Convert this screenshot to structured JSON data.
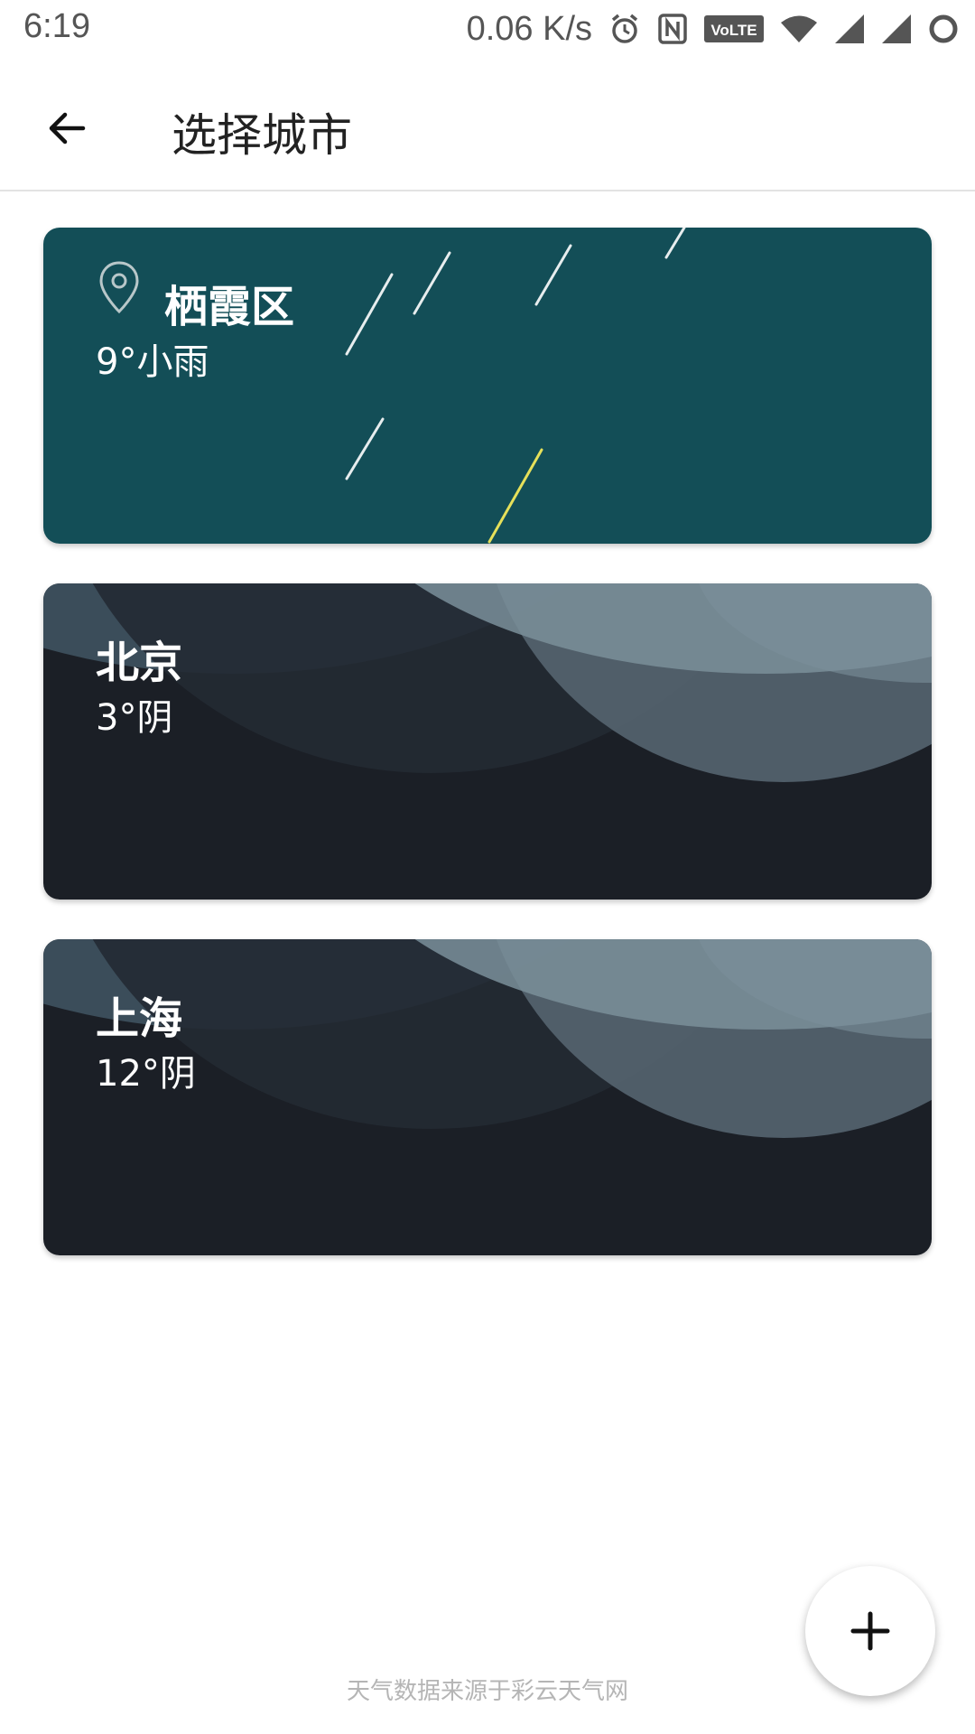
{
  "status_bar": {
    "time": "6:19",
    "speed": "0.06 K/s",
    "icons": [
      "alarm-icon",
      "nfc-icon",
      "volte-icon",
      "wifi-icon",
      "signal-icon",
      "signal-icon",
      "loading-icon"
    ]
  },
  "app_bar": {
    "back_icon": "arrow-left-icon",
    "title": "选择城市"
  },
  "cities": [
    {
      "name": "栖霞区",
      "weather": "9°小雨",
      "is_location": true,
      "background": "rain",
      "bg_color": "#134e57"
    },
    {
      "name": "北京",
      "weather": "3°阴",
      "is_location": false,
      "background": "cloudy",
      "bg_color": "#1b1f26"
    },
    {
      "name": "上海",
      "weather": "12°阴",
      "is_location": false,
      "background": "cloudy",
      "bg_color": "#1b1f26"
    }
  ],
  "fab": {
    "icon": "plus-icon"
  },
  "footer": {
    "note": "天气数据来源于彩云天气网"
  }
}
